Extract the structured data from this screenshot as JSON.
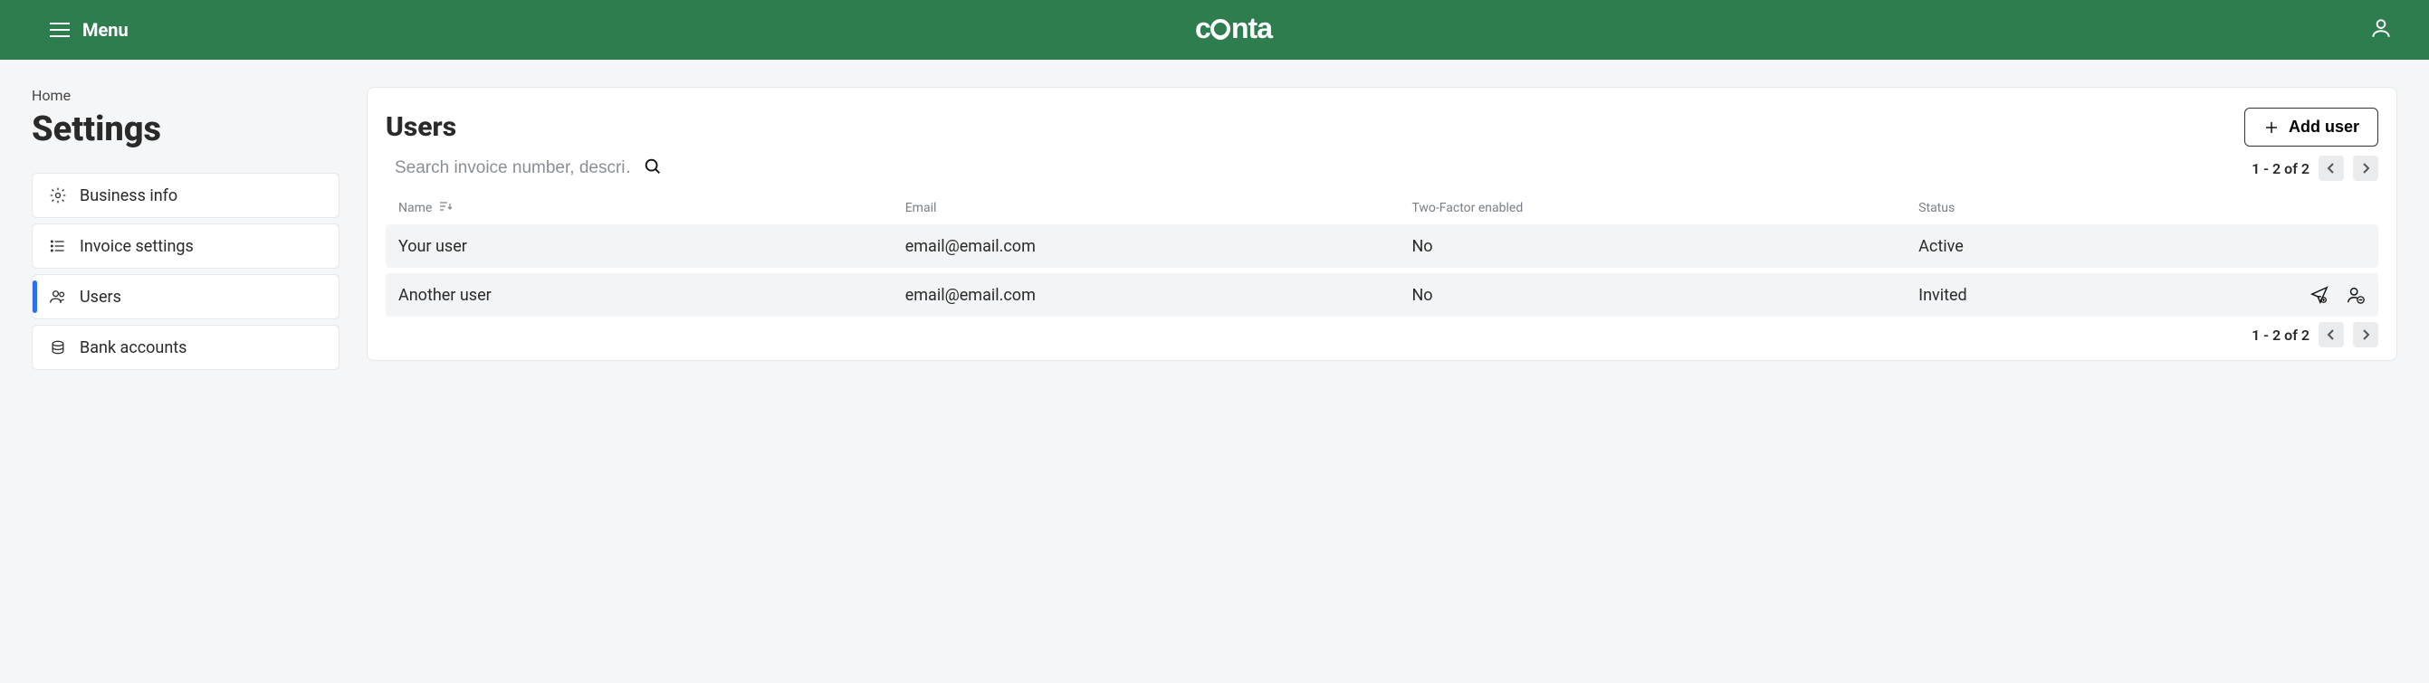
{
  "header": {
    "menu_label": "Menu",
    "brand": "conta"
  },
  "breadcrumb": "Home",
  "page_title": "Settings",
  "sidebar": {
    "items": [
      {
        "label": "Business info"
      },
      {
        "label": "Invoice settings"
      },
      {
        "label": "Users"
      },
      {
        "label": "Bank accounts"
      }
    ]
  },
  "panel": {
    "title": "Users",
    "add_label": "Add user",
    "search_placeholder": "Search invoice number, descri…",
    "pagination": "1 - 2 of 2",
    "columns": {
      "name": "Name",
      "email": "Email",
      "tfa": "Two-Factor enabled",
      "status": "Status"
    },
    "rows": [
      {
        "name": "Your user",
        "email": "email@email.com",
        "tfa": "No",
        "status": "Active"
      },
      {
        "name": "Another user",
        "email": "email@email.com",
        "tfa": "No",
        "status": "Invited"
      }
    ]
  }
}
